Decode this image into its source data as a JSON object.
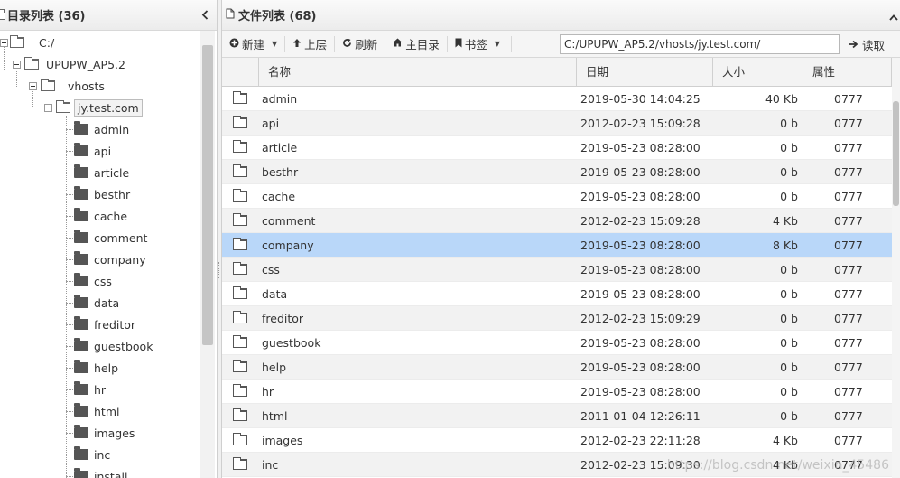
{
  "left_panel": {
    "title": "目录列表 (36)",
    "collapse_icon": "chevron-left-icon",
    "tree": {
      "root": "C:/",
      "level1": "UPUPW_AP5.2",
      "level2": "vhosts",
      "level3": "jy.test.com",
      "children": [
        "admin",
        "api",
        "article",
        "besthr",
        "cache",
        "comment",
        "company",
        "css",
        "data",
        "freditor",
        "guestbook",
        "help",
        "hr",
        "html",
        "images",
        "inc",
        "install"
      ]
    }
  },
  "right_panel": {
    "title": "文件列表 (68)",
    "toolbar": {
      "new_label": "新建",
      "up_label": "上层",
      "refresh_label": "刷新",
      "home_label": "主目录",
      "bookmark_label": "书签",
      "path_value": "C:/UPUPW_AP5.2/vhosts/jy.test.com/",
      "read_label": "读取"
    },
    "columns": {
      "name": "名称",
      "date": "日期",
      "size": "大小",
      "attr": "属性"
    },
    "rows": [
      {
        "name": "admin",
        "date": "2019-05-30 14:04:25",
        "size": "40 Kb",
        "attr": "0777"
      },
      {
        "name": "api",
        "date": "2012-02-23 15:09:28",
        "size": "0 b",
        "attr": "0777"
      },
      {
        "name": "article",
        "date": "2019-05-23 08:28:00",
        "size": "0 b",
        "attr": "0777"
      },
      {
        "name": "besthr",
        "date": "2019-05-23 08:28:00",
        "size": "0 b",
        "attr": "0777"
      },
      {
        "name": "cache",
        "date": "2019-05-23 08:28:00",
        "size": "0 b",
        "attr": "0777"
      },
      {
        "name": "comment",
        "date": "2012-02-23 15:09:28",
        "size": "4 Kb",
        "attr": "0777"
      },
      {
        "name": "company",
        "date": "2019-05-23 08:28:00",
        "size": "8 Kb",
        "attr": "0777",
        "selected": true
      },
      {
        "name": "css",
        "date": "2019-05-23 08:28:00",
        "size": "0 b",
        "attr": "0777"
      },
      {
        "name": "data",
        "date": "2019-05-23 08:28:00",
        "size": "0 b",
        "attr": "0777"
      },
      {
        "name": "freditor",
        "date": "2012-02-23 15:09:29",
        "size": "0 b",
        "attr": "0777"
      },
      {
        "name": "guestbook",
        "date": "2019-05-23 08:28:00",
        "size": "0 b",
        "attr": "0777"
      },
      {
        "name": "help",
        "date": "2019-05-23 08:28:00",
        "size": "0 b",
        "attr": "0777"
      },
      {
        "name": "hr",
        "date": "2019-05-23 08:28:00",
        "size": "0 b",
        "attr": "0777"
      },
      {
        "name": "html",
        "date": "2011-01-04 12:26:11",
        "size": "0 b",
        "attr": "0777"
      },
      {
        "name": "images",
        "date": "2012-02-23 22:11:28",
        "size": "4 Kb",
        "attr": "0777"
      },
      {
        "name": "inc",
        "date": "2012-02-23 15:09:30",
        "size": "4 Kb",
        "attr": "0777"
      }
    ]
  },
  "watermark": "https://blog.csdn.net/weixin_45486"
}
